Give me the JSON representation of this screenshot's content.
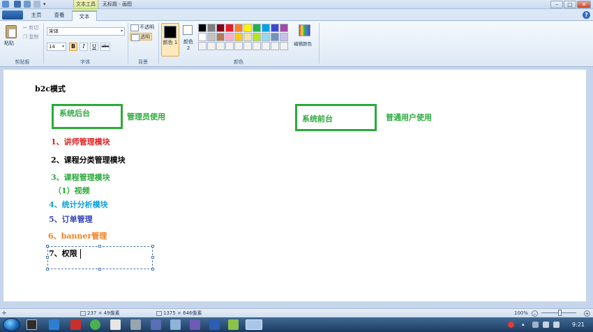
{
  "titlebar": {
    "context_tab_group": "文本工具",
    "window_title": "无标题 - 画图",
    "controls": [
      "–",
      "□",
      "✕"
    ]
  },
  "tabs": {
    "home": "主页",
    "view": "查看",
    "text": "文本",
    "help": "?"
  },
  "clipboard": {
    "paste": "粘贴",
    "cut": "剪切",
    "copy": "复制",
    "group": "剪贴板"
  },
  "font": {
    "family": "宋体",
    "size": "14",
    "bold": "B",
    "italic": "I",
    "underline": "U",
    "strike": "abc",
    "group": "字体"
  },
  "background": {
    "opaque": "不透明",
    "transparent": "透明",
    "group": "背景"
  },
  "colors": {
    "color1_label": "颜色 1",
    "color2_label": "颜色 2",
    "edit_colors": "编辑颜色",
    "group": "颜色",
    "color1": "#000000",
    "color2": "#ffffff",
    "palette_row1": [
      "#000000",
      "#7f7f7f",
      "#880015",
      "#ed1c24",
      "#ff7f27",
      "#fff200",
      "#22b14c",
      "#00a2e8",
      "#3f48cc",
      "#a349a4"
    ],
    "palette_row2": [
      "#ffffff",
      "#c3c3c3",
      "#b97a57",
      "#ffaec9",
      "#ffc90e",
      "#efe4b0",
      "#b5e61d",
      "#99d9ea",
      "#7092be",
      "#c8bfe7"
    ],
    "custom_row": [
      "#f2f2f2",
      "#f2f2f2",
      "#f2f2f2",
      "#f2f2f2",
      "#f2f2f2",
      "#f2f2f2",
      "#f2f2f2",
      "#f2f2f2",
      "#f2f2f2",
      "#f2f2f2"
    ]
  },
  "canvas": {
    "heading": "b2c模式",
    "backend_box": "系统后台",
    "admin_use": "管理员使用",
    "frontend_box": "系统前台",
    "user_use": "普通用户使用",
    "items": [
      {
        "text": "1、讲师管理模块",
        "color": "#e02020"
      },
      {
        "text": "2、课程分类管理模块",
        "color": "#000000"
      },
      {
        "text": "3、课程管理模块",
        "color": "#2aaa3a"
      },
      {
        "text": "（1）视频",
        "color": "#2aaa3a"
      },
      {
        "text": "4、统计分析模块",
        "color": "#0aa0d8"
      },
      {
        "text": "5、订单管理",
        "color": "#3040b8"
      },
      {
        "text": "6、banner管理",
        "color": "#f08020"
      },
      {
        "text": "7、权限",
        "color": "#000000"
      }
    ],
    "box_color": "#2aaa3a"
  },
  "status": {
    "selection_size": "237 × 49像素",
    "image_size": "1375 × 646像素",
    "zoom": "100%",
    "zoom_out": "–",
    "zoom_in": "+"
  },
  "taskbar": {
    "clock": "9:21"
  }
}
